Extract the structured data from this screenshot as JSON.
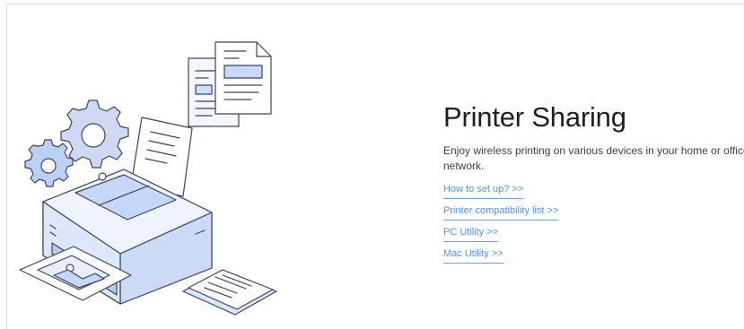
{
  "page": {
    "title": "Printer Sharing",
    "description": "Enjoy wireless printing on various devices in your home or office network.",
    "links": [
      {
        "label": "How to set up? >>"
      },
      {
        "label": "Printer compatibility list >>"
      },
      {
        "label": "PC Utility >>"
      },
      {
        "label": "Mac Utility >>"
      }
    ]
  },
  "colors": {
    "accent": "#5a8fe0",
    "title": "#1f1f1f",
    "text": "#3b3f45",
    "illustration_fill": "#dce6fb",
    "illustration_stroke": "#3c4460"
  },
  "icons": {
    "illustration": "printer-illustration",
    "gears": "gear-icon",
    "documents": "document-icon"
  }
}
